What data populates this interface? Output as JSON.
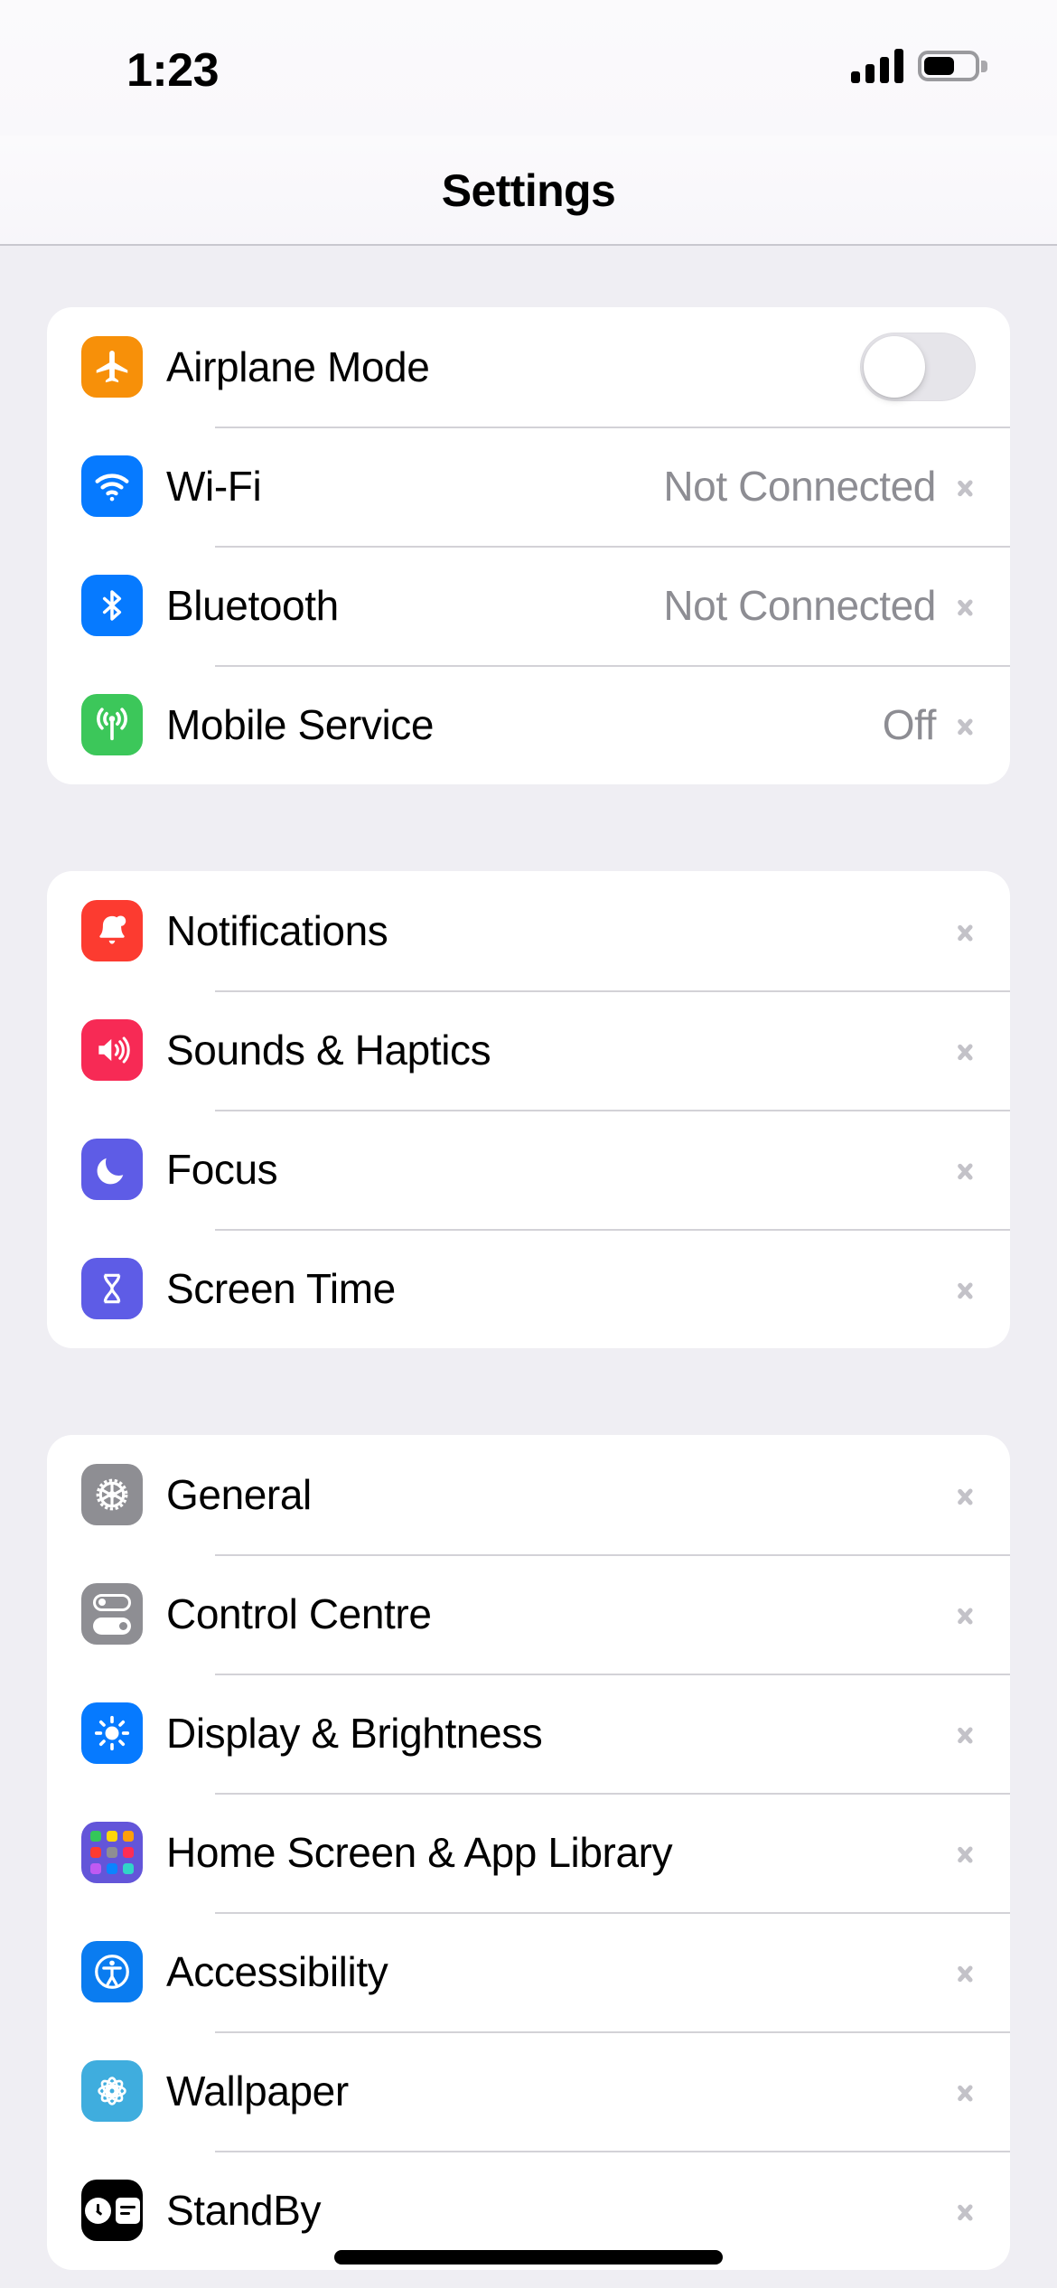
{
  "status_bar": {
    "time": "1:23",
    "signal_icon": "cellular-signal-icon",
    "signal_bars_filled": 4,
    "battery_icon": "battery-icon",
    "battery_level_percent": 60
  },
  "header": {
    "title": "Settings"
  },
  "groups": [
    {
      "id": "connectivity",
      "rows": [
        {
          "label": "Airplane Mode",
          "icon": "airplane-icon",
          "icon_color": "#f79009",
          "control": "toggle",
          "toggle_on": false
        },
        {
          "label": "Wi-Fi",
          "icon": "wifi-icon",
          "icon_color": "#067aff",
          "control": "chevron",
          "value": "Not Connected"
        },
        {
          "label": "Bluetooth",
          "icon": "bluetooth-icon",
          "icon_color": "#067aff",
          "control": "chevron",
          "value": "Not Connected"
        },
        {
          "label": "Mobile Service",
          "icon": "antenna-icon",
          "icon_color": "#3cc75a",
          "control": "chevron",
          "value": "Off"
        }
      ]
    },
    {
      "id": "alerts",
      "rows": [
        {
          "label": "Notifications",
          "icon": "bell-icon",
          "icon_color": "#fc3b30",
          "control": "chevron",
          "value": ""
        },
        {
          "label": "Sounds & Haptics",
          "icon": "speaker-icon",
          "icon_color": "#f72a55",
          "control": "chevron",
          "value": ""
        },
        {
          "label": "Focus",
          "icon": "moon-icon",
          "icon_color": "#5e5ce6",
          "control": "chevron",
          "value": ""
        },
        {
          "label": "Screen Time",
          "icon": "hourglass-icon",
          "icon_color": "#5e5ce6",
          "control": "chevron",
          "value": ""
        }
      ]
    },
    {
      "id": "system",
      "rows": [
        {
          "label": "General",
          "icon": "gear-icon",
          "icon_color": "#8e8e93",
          "control": "chevron",
          "value": ""
        },
        {
          "label": "Control Centre",
          "icon": "control-toggles-icon",
          "icon_color": "#8e8e93",
          "control": "chevron",
          "value": ""
        },
        {
          "label": "Display & Brightness",
          "icon": "sun-icon",
          "icon_color": "#067aff",
          "control": "chevron",
          "value": ""
        },
        {
          "label": "Home Screen & App Library",
          "icon": "app-grid-icon",
          "icon_color": "#6355d9",
          "control": "chevron",
          "value": ""
        },
        {
          "label": "Accessibility",
          "icon": "accessibility-icon",
          "icon_color": "#0a7cf0",
          "control": "chevron",
          "value": ""
        },
        {
          "label": "Wallpaper",
          "icon": "flower-icon",
          "icon_color": "#3fadde",
          "control": "chevron",
          "value": ""
        },
        {
          "label": "StandBy",
          "icon": "standby-icon",
          "icon_color": "#000000",
          "control": "chevron",
          "value": ""
        }
      ]
    }
  ],
  "app_grid_colors": [
    "#34c759",
    "#ffd60a",
    "#ff9f0a",
    "#ff3b30",
    "#8e8e93",
    "#ff2d55",
    "#bf5af2",
    "#0a84ff",
    "#30d5c8"
  ],
  "home_indicator": "home-indicator"
}
